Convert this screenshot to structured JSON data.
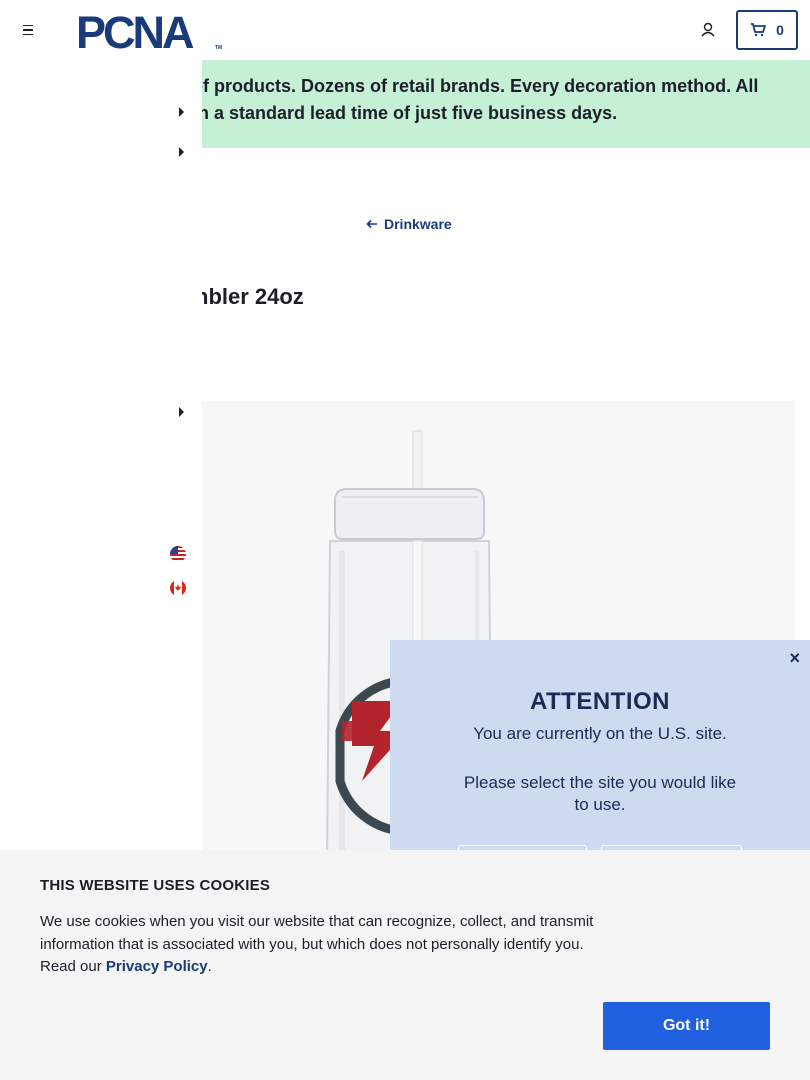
{
  "header": {
    "logo_text": "PCNA",
    "logo_tm": "TM",
    "cart_count": "0",
    "brand_color": "#1a3a7a"
  },
  "promo": {
    "line1": "ls of products. Dozens of retail brands. Every decoration method. All",
    "line2": "th a standard lead time of just five business days."
  },
  "breadcrumb": {
    "back_label": "Drinkware"
  },
  "product": {
    "title_visible": "nbler 24oz"
  },
  "site_modal": {
    "close_symbol": "×",
    "title": "ATTENTION",
    "message": "You are currently on the U.S. site.",
    "question": "Please select the site you would like to use.",
    "panel_color": "#cddaf0"
  },
  "cookies": {
    "title": "THIS WEBSITE USES COOKIES",
    "text": "We use cookies when you visit our website that can recognize, collect, and transmit information that is associated with you, but which does not personally identify you. Read our ",
    "link_label": "Privacy Policy",
    "text_end": ".",
    "accept_label": "Got it!",
    "accept_color": "#1f5fe0"
  },
  "promo_color": "#c6f0d5"
}
